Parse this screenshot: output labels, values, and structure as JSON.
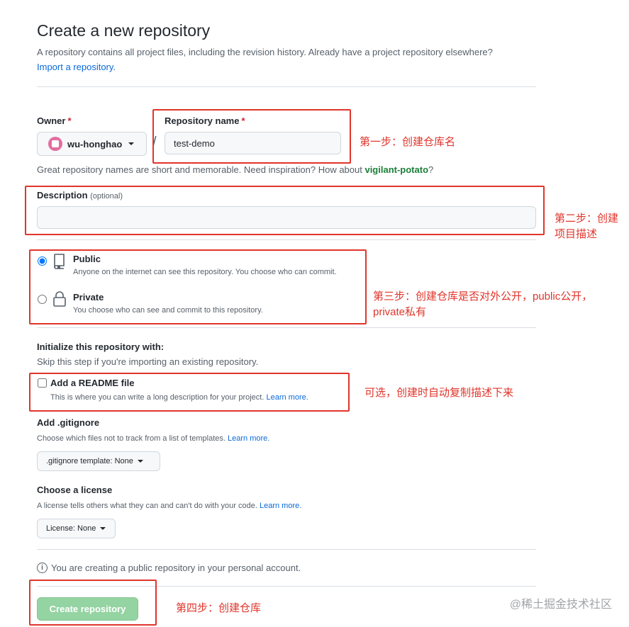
{
  "page": {
    "title": "Create a new repository",
    "subtitle": "A repository contains all project files, including the revision history. Already have a project repository elsewhere?",
    "import_link": "Import a repository."
  },
  "owner": {
    "label": "Owner",
    "required_mark": "*",
    "value": "wu-honghao"
  },
  "repo_name": {
    "label": "Repository name",
    "required_mark": "*",
    "value": "test-demo"
  },
  "name_hint": {
    "prefix": "Great repository names are short and memorable. Need inspiration? How about ",
    "suggestion": "vigilant-potato",
    "suffix": "?"
  },
  "description": {
    "label": "Description",
    "optional": "(optional)",
    "value": ""
  },
  "visibility": {
    "public": {
      "title": "Public",
      "desc": "Anyone on the internet can see this repository. You choose who can commit.",
      "selected": true
    },
    "private": {
      "title": "Private",
      "desc": "You choose who can see and commit to this repository.",
      "selected": false
    }
  },
  "init": {
    "title": "Initialize this repository with:",
    "desc": "Skip this step if you're importing an existing repository.",
    "readme_title": "Add a README file",
    "readme_desc": "This is where you can write a long description for your project. ",
    "readme_learn": "Learn more.",
    "readme_checked": false
  },
  "gitignore": {
    "title": "Add .gitignore",
    "desc": "Choose which files not to track from a list of templates. ",
    "learn": "Learn more.",
    "select": ".gitignore template: None"
  },
  "license": {
    "title": "Choose a license",
    "desc": "A license tells others what they can and can't do with your code. ",
    "learn": "Learn more.",
    "select": "License: None"
  },
  "info": {
    "icon": "i",
    "text": "You are creating a public repository in your personal account."
  },
  "create_button": "Create repository",
  "annotations": {
    "step1": "第一步：创建仓库名",
    "step2_line1": "第二步：创建",
    "step2_line2": "项目描述",
    "step3_line1": "第三步：创建仓库是否对外公开，public公开，",
    "step3_line2": "private私有",
    "optional_note": "可选，创建时自动复制描述下来",
    "step4": "第四步：创建仓库"
  },
  "watermark": "@稀土掘金技术社区",
  "colors": {
    "accent_link": "#0969da",
    "required": "#cf222e",
    "suggestion_green": "#1a7f37",
    "create_button": "#94d3a2",
    "annotation_red": "#e0352b"
  }
}
